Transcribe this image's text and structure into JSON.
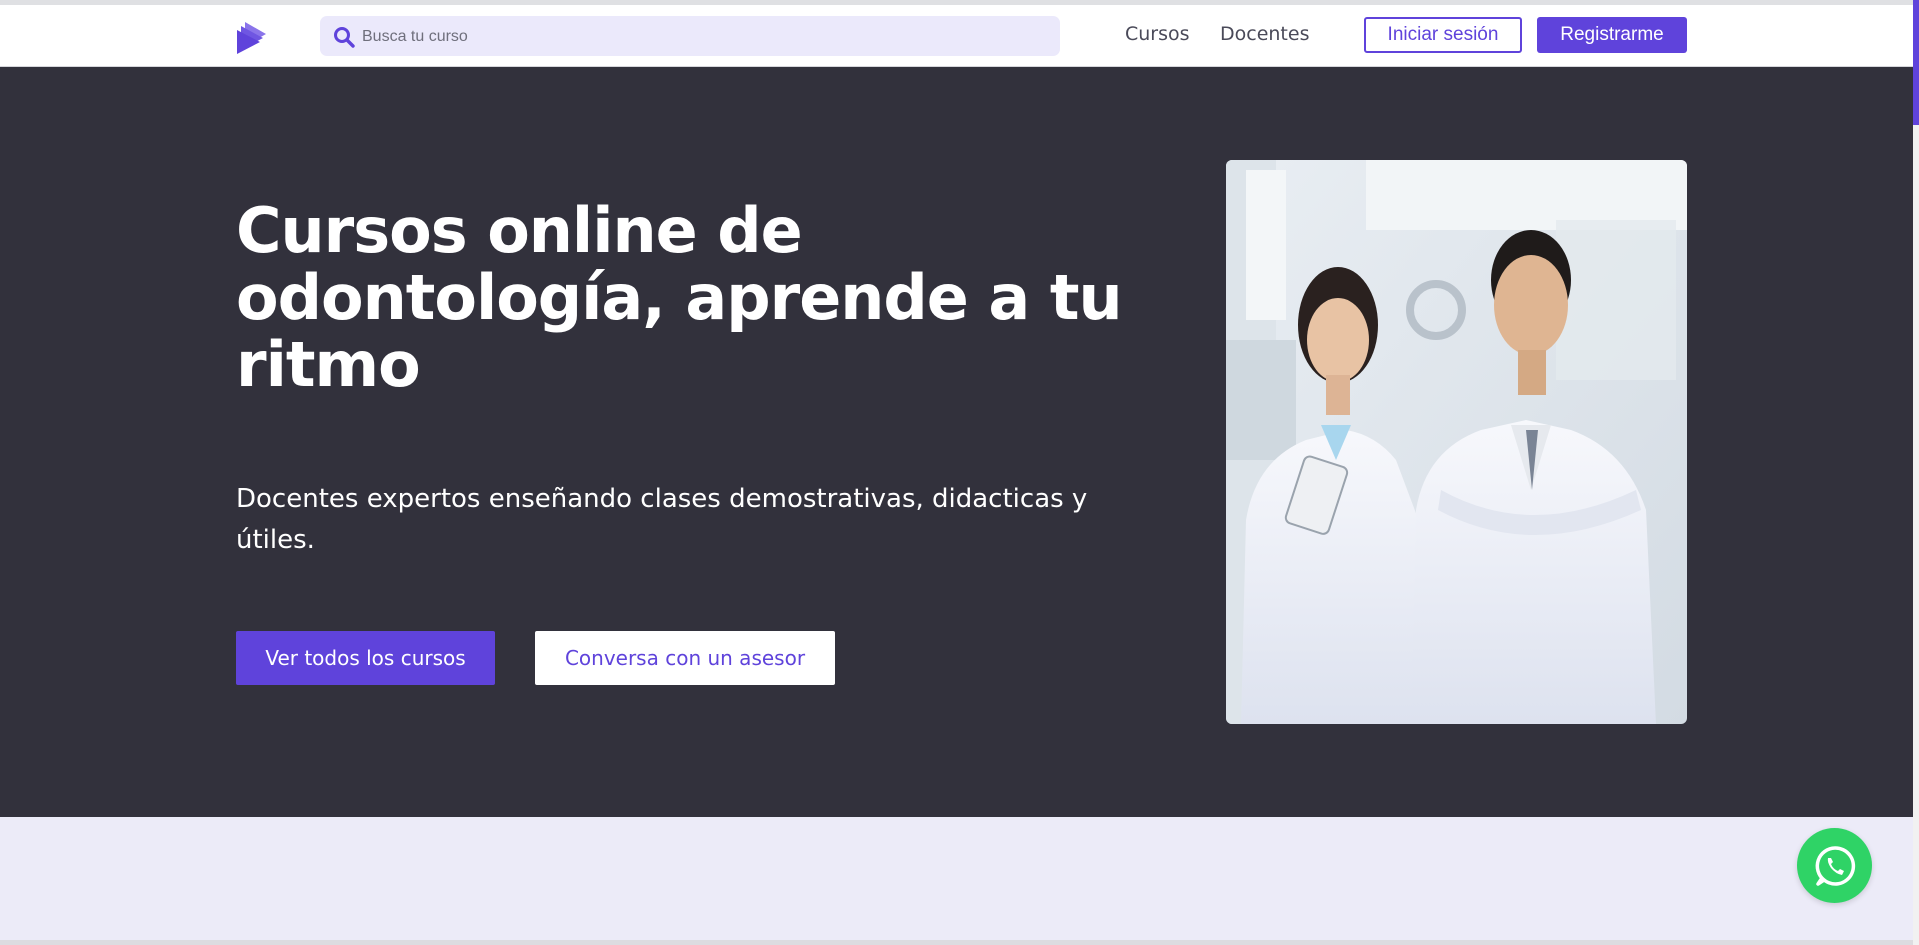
{
  "colors": {
    "brand": "#5f43db",
    "hero_bg": "#32313c",
    "section_bg": "#ecebf8",
    "whatsapp": "#2fd366"
  },
  "header": {
    "logo_icon": "play-stack-logo-icon",
    "search": {
      "placeholder": "Busca tu curso",
      "value": "",
      "icon": "search-icon"
    },
    "nav": [
      {
        "label": "Cursos"
      },
      {
        "label": "Docentes"
      }
    ],
    "login_label": "Iniciar sesión",
    "register_label": "Registrarme"
  },
  "hero": {
    "title": "Cursos online de odontología, aprende a tu ritmo",
    "subtitle": "Docentes expertos enseñando clases demostrativas, didacticas y útiles.",
    "primary_cta": "Ver todos los cursos",
    "secondary_cta": "Conversa con un asesor",
    "image": "two-dentists-in-white-coats-photo"
  },
  "floating": {
    "whatsapp_icon": "whatsapp-icon"
  }
}
